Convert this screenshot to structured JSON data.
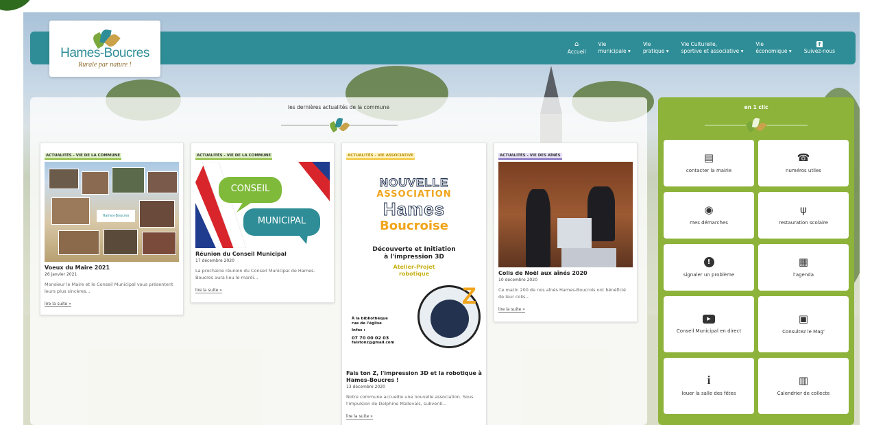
{
  "logo": {
    "name": "Hames-Boucres",
    "tagline": "Rurale par nature !"
  },
  "nav": [
    {
      "icon": "home-icon",
      "glyph": "⌂",
      "line1": "",
      "line2": "Accueil",
      "caret": false
    },
    {
      "icon": "",
      "glyph": "",
      "line1": "Vie",
      "line2": "municipale ▾",
      "caret": true
    },
    {
      "icon": "",
      "glyph": "",
      "line1": "Vie",
      "line2": "pratique ▾",
      "caret": true
    },
    {
      "icon": "",
      "glyph": "",
      "line1": "Vie Culturelle,",
      "line2": "sportive et associative ▾",
      "caret": true
    },
    {
      "icon": "",
      "glyph": "",
      "line1": "Vie",
      "line2": "économique ▾",
      "caret": true
    },
    {
      "icon": "facebook-icon",
      "glyph": "f",
      "line1": "",
      "line2": "Suivez-nous",
      "caret": false
    }
  ],
  "news": {
    "title": "les dernières actualités de la commune",
    "cards": [
      {
        "category": "ACTUALITÉS - VIE DE LA COMMUNE",
        "title": "Voeux du Maire 2021",
        "date": "26 janvier 2021",
        "excerpt": "Monsieur le Maire et le Conseil Municipal vous présentent leurs plus sincères...",
        "more": "lire la suite »",
        "image_badge": "Hames-Boucres"
      },
      {
        "category": "ACTUALITÉS - VIE DE LA COMMUNE",
        "title": "Réunion du Conseil Municipal",
        "date": "17 décembre 2020",
        "excerpt": "La prochaine réunion du Conseil Municipal de Hames-Boucres aura lieu le mardi...",
        "more": "lire la suite »",
        "bubble1": "CONSEIL",
        "bubble2": "MUNICIPAL"
      },
      {
        "category": "ACTUALITÉS - VIE ASSOCIATIVE",
        "title": "Fais ton Z, l'impression 3D et la robotique à Hames-Boucres !",
        "date": "13 décembre 2020",
        "excerpt": "Notre commune accueille une nouvelle association. Sous l'impulsion de Delphine Mallevals, subventi...",
        "more": "lire la suite »",
        "poster": {
          "line1": "NOUVELLE",
          "line2": "ASSOCIATION",
          "line3": "Hames",
          "line4": "Boucroise",
          "line5": "Découverte et Initiation",
          "line6": "à l'impression 3D",
          "line7": "Atelier-Projet",
          "line8": "robotique",
          "loc1": "À la bibliothèque",
          "loc2": "rue de l'église",
          "info": "Infos :",
          "phone": "07 70 00 02 03",
          "email": "faistonz@gmail.com",
          "badge": "Z"
        }
      },
      {
        "category": "ACTUALITÉS - VIE DES AÎNÉS",
        "title": "Colis de Noël aux aînés 2020",
        "date": "10 décembre 2020",
        "excerpt": "Ce matin 200 de nos aînés Hames-Boucrois ont bénéficié de leur colis...",
        "more": "lire la suite »"
      }
    ]
  },
  "quick": {
    "title": "en 1 clic",
    "tiles": [
      {
        "icon": "contact-card-icon",
        "glyph": "▤",
        "label": "contacter la mairie"
      },
      {
        "icon": "phone-book-icon",
        "glyph": "☎",
        "label": "numéros utiles"
      },
      {
        "icon": "mouse-icon",
        "glyph": "◉",
        "label": "mes démarches"
      },
      {
        "icon": "cutlery-icon",
        "glyph": "ψ",
        "label": "restauration scolaire"
      },
      {
        "icon": "alert-icon",
        "glyph": "!",
        "label": "signaler un problème"
      },
      {
        "icon": "calendar-icon",
        "glyph": "▦",
        "label": "l'agenda"
      },
      {
        "icon": "youtube-icon",
        "glyph": "▶",
        "label": "Conseil Municipal en direct"
      },
      {
        "icon": "magazine-icon",
        "glyph": "▣",
        "label": "Consultez le Mag'"
      },
      {
        "icon": "info-icon",
        "glyph": "i",
        "label": "louer la salle des fêtes"
      },
      {
        "icon": "trash-icon",
        "glyph": "▥",
        "label": "Calendrier de collecte"
      }
    ]
  },
  "colors": {
    "teal": "#2e8d96",
    "green": "#8db33a"
  }
}
